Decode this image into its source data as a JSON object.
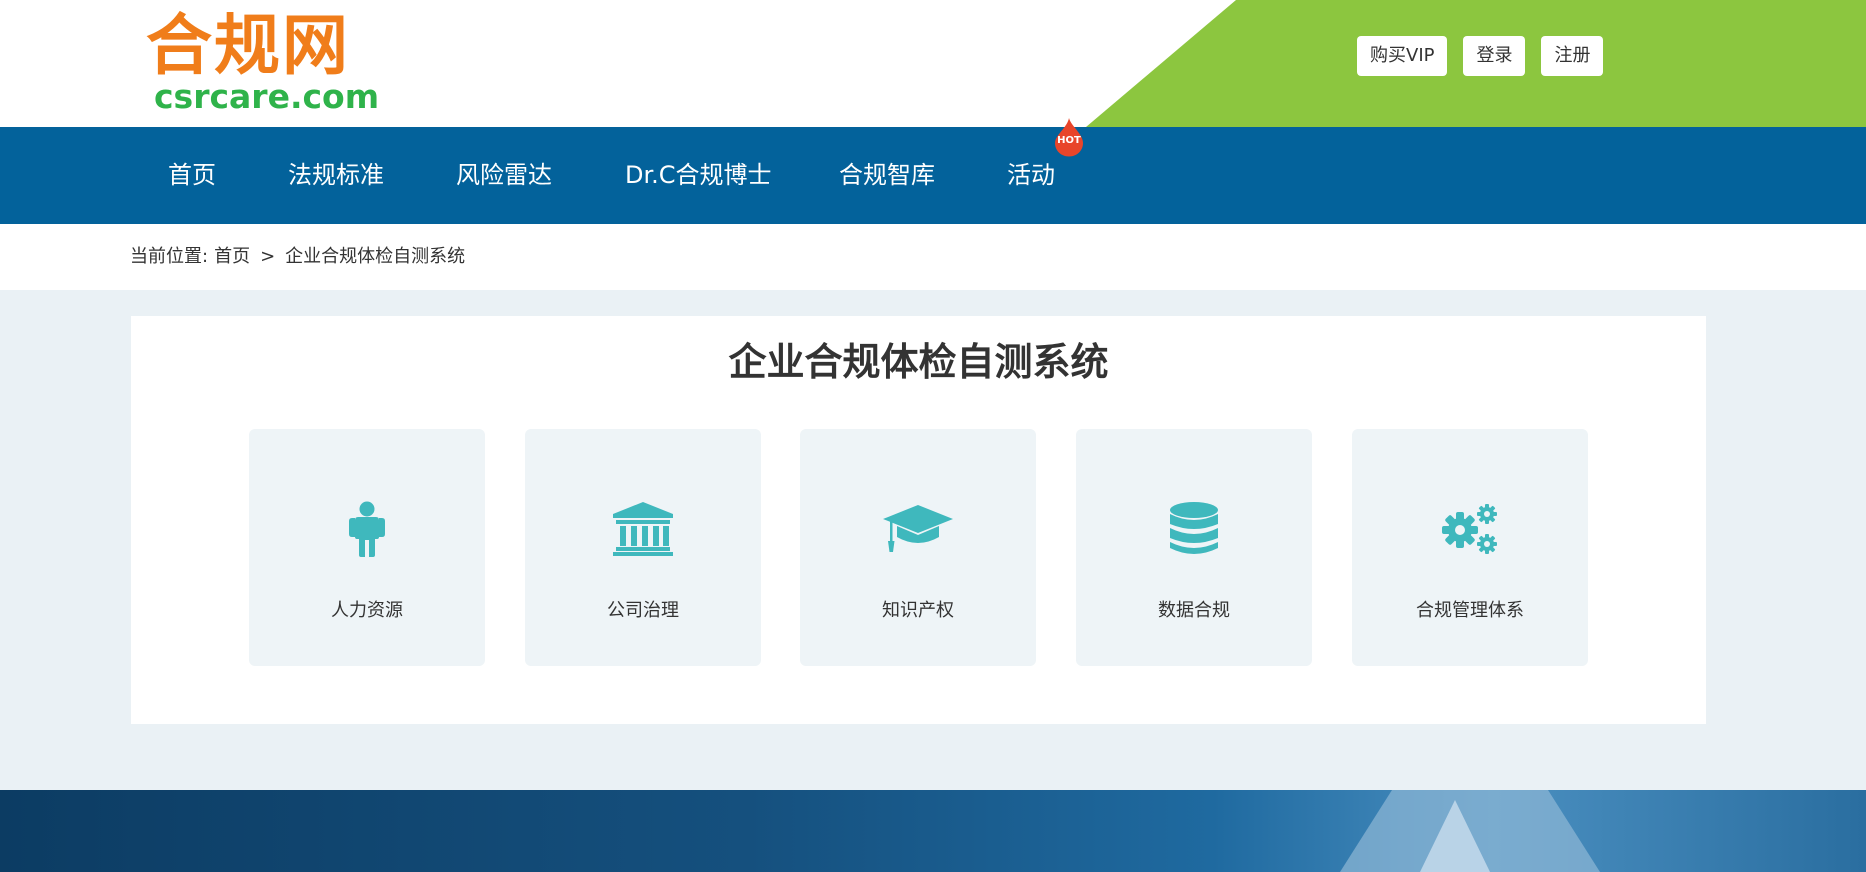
{
  "logo": {
    "cn": "合规网",
    "en": "csrcare.com"
  },
  "top_buttons": [
    "购买VIP",
    "登录",
    "注册"
  ],
  "nav": {
    "items": [
      "首页",
      "法规标准",
      "风险雷达",
      "Dr.C合规博士",
      "合规智库",
      "活动"
    ],
    "hot_badge": "HOT"
  },
  "breadcrumb": {
    "label": "当前位置:",
    "home": "首页",
    "separator": ">",
    "current": "企业合规体检自测系统"
  },
  "main": {
    "title": "企业合规体检自测系统",
    "categories": [
      {
        "label": "人力资源",
        "icon": "person-icon"
      },
      {
        "label": "公司治理",
        "icon": "institution-icon"
      },
      {
        "label": "知识产权",
        "icon": "graduation-cap-icon"
      },
      {
        "label": "数据合规",
        "icon": "database-icon"
      },
      {
        "label": "合规管理体系",
        "icon": "gears-icon"
      }
    ]
  },
  "colors": {
    "nav_bg": "#03629b",
    "header_accent": "#8cc63f",
    "logo_orange": "#f07d1a",
    "logo_green": "#2fb34a",
    "icon_teal": "#3fb8bd",
    "hot_red": "#e8452a"
  }
}
